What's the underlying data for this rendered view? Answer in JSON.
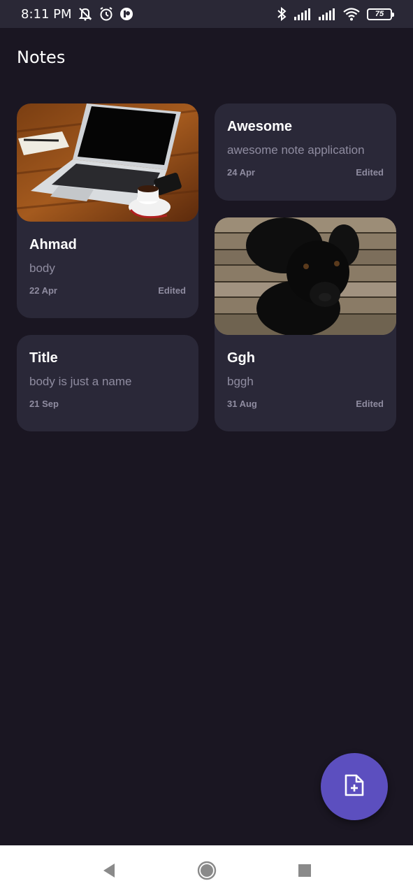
{
  "status_bar": {
    "time": "8:11 PM",
    "battery": "75",
    "icons": [
      "muted-bell-icon",
      "alarm-icon",
      "app-notification-icon",
      "bluetooth-icon",
      "signal-icon",
      "signal-icon",
      "wifi-icon",
      "battery-icon"
    ]
  },
  "header": {
    "title": "Notes"
  },
  "notes": [
    {
      "title": "Ahmad",
      "body": "body",
      "date": "22 Apr",
      "edited": "Edited",
      "image": "laptop-coffee-photo"
    },
    {
      "title": "Title",
      "body": "body is just a name",
      "date": "21 Sep"
    },
    {
      "title": "Awesome",
      "body": "awesome note application",
      "date": "24 Apr",
      "edited": "Edited"
    },
    {
      "title": "Ggh",
      "body": "bggh",
      "date": "31 Aug",
      "edited": "Edited",
      "image": "black-dog-photo"
    }
  ],
  "fab": {
    "icon": "add-note-icon",
    "color": "#5c4fbf"
  },
  "nav_bar": {
    "icons": [
      "back-icon",
      "home-icon",
      "recents-icon"
    ]
  },
  "colors": {
    "background": "#1a1622",
    "card": "#2a2838",
    "muted_text": "#8f8ca0",
    "accent": "#5c4fbf"
  }
}
